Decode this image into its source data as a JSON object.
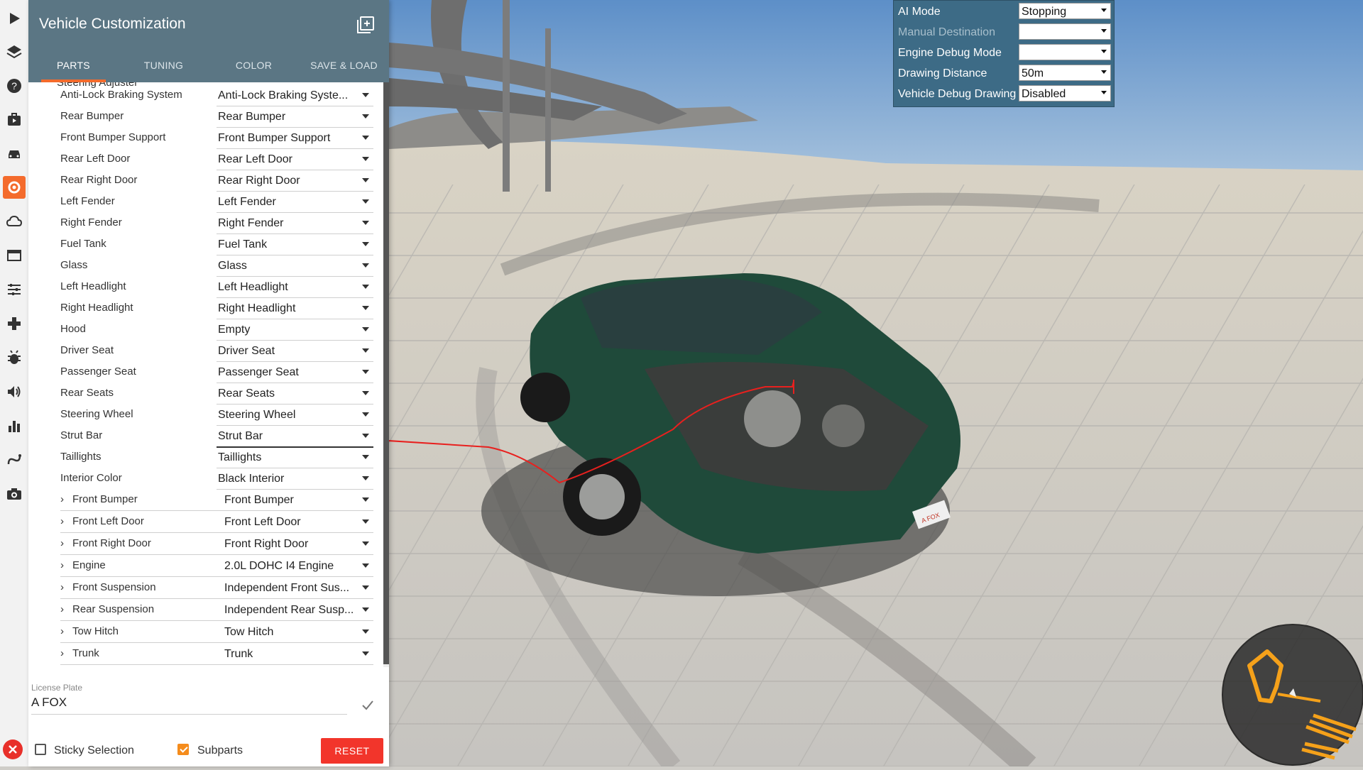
{
  "panel": {
    "title": "Vehicle Customization",
    "tabs": [
      {
        "label": "PARTS",
        "active": true
      },
      {
        "label": "TUNING",
        "active": false
      },
      {
        "label": "COLOR",
        "active": false
      },
      {
        "label": "SAVE & LOAD",
        "active": false
      }
    ],
    "scroll_cut_label": "Steering Adjuster",
    "parts": [
      {
        "label": "Anti-Lock Braking System",
        "value": "Anti-Lock Braking Syste...",
        "expandable": false
      },
      {
        "label": "Rear Bumper",
        "value": "Rear Bumper",
        "expandable": false
      },
      {
        "label": "Front Bumper Support",
        "value": "Front Bumper Support",
        "expandable": false
      },
      {
        "label": "Rear Left Door",
        "value": "Rear Left Door",
        "expandable": false
      },
      {
        "label": "Rear Right Door",
        "value": "Rear Right Door",
        "expandable": false
      },
      {
        "label": "Left Fender",
        "value": "Left Fender",
        "expandable": false
      },
      {
        "label": "Right Fender",
        "value": "Right Fender",
        "expandable": false
      },
      {
        "label": "Fuel Tank",
        "value": "Fuel Tank",
        "expandable": false
      },
      {
        "label": "Glass",
        "value": "Glass",
        "expandable": false
      },
      {
        "label": "Left Headlight",
        "value": "Left Headlight",
        "expandable": false
      },
      {
        "label": "Right Headlight",
        "value": "Right Headlight",
        "expandable": false
      },
      {
        "label": "Hood",
        "value": "Empty",
        "expandable": false
      },
      {
        "label": "Driver Seat",
        "value": "Driver Seat",
        "expandable": false
      },
      {
        "label": "Passenger Seat",
        "value": "Passenger Seat",
        "expandable": false
      },
      {
        "label": "Rear Seats",
        "value": "Rear Seats",
        "expandable": false
      },
      {
        "label": "Steering Wheel",
        "value": "Steering Wheel",
        "expandable": false
      },
      {
        "label": "Strut Bar",
        "value": "Strut Bar",
        "expandable": false,
        "focused": true
      },
      {
        "label": "Taillights",
        "value": "Taillights",
        "expandable": false
      },
      {
        "label": "Interior Color",
        "value": "Black Interior",
        "expandable": false
      },
      {
        "label": "Front Bumper",
        "value": "Front Bumper",
        "expandable": true
      },
      {
        "label": "Front Left Door",
        "value": "Front Left Door",
        "expandable": true
      },
      {
        "label": "Front Right Door",
        "value": "Front Right Door",
        "expandable": true
      },
      {
        "label": "Engine",
        "value": "2.0L DOHC I4 Engine",
        "expandable": true
      },
      {
        "label": "Front Suspension",
        "value": "Independent Front Sus...",
        "expandable": true
      },
      {
        "label": "Rear Suspension",
        "value": "Independent Rear Susp...",
        "expandable": true
      },
      {
        "label": "Tow Hitch",
        "value": "Tow Hitch",
        "expandable": true
      },
      {
        "label": "Trunk",
        "value": "Trunk",
        "expandable": true
      }
    ],
    "license_plate": {
      "label": "License Plate",
      "value": "A FOX"
    },
    "footer": {
      "sticky_selection_label": "Sticky Selection",
      "sticky_selection_checked": false,
      "subparts_label": "Subparts",
      "subparts_checked": true,
      "reset_label": "RESET"
    }
  },
  "ai_panel": {
    "rows": [
      {
        "label": "AI Mode",
        "value": "Stopping",
        "disabled": false
      },
      {
        "label": "Manual Destination",
        "value": "",
        "disabled": true
      },
      {
        "label": "Engine Debug Mode",
        "value": "",
        "disabled": false
      },
      {
        "label": "Drawing Distance",
        "value": "50m",
        "disabled": false
      },
      {
        "label": "Vehicle Debug Drawing",
        "value": "Disabled",
        "disabled": false
      }
    ]
  },
  "scene": {
    "car_license_text": "A FOX"
  },
  "colors": {
    "header": "#5b7684",
    "tab_indicator": "#f46b2c",
    "reset": "#f2352b",
    "checkbox_checked": "#f58c1c",
    "ai_panel": "#3d6b86",
    "annotation": "#e8201e",
    "car_body": "#1f4a3a"
  },
  "sidebar_icons": [
    "play-icon",
    "layers-icon",
    "help-icon",
    "bag-icon",
    "car-icon",
    "gear-icon",
    "cloud-icon",
    "window-icon",
    "sliders-icon",
    "gamepad-icon",
    "bug-icon",
    "volume-icon",
    "bar-chart-icon",
    "path-icon",
    "camera-icon"
  ]
}
